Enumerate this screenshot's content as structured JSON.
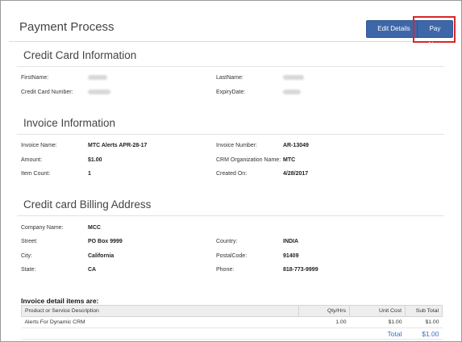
{
  "header": {
    "title": "Payment Process",
    "edit_label": "Edit Details",
    "pay_label": "Pay Now"
  },
  "credit_card": {
    "title": "Credit Card Information",
    "first_name_label": "FirstName:",
    "last_name_label": "LastName:",
    "card_number_label": "Credit Card Number:",
    "expiry_label": "ExpiryDate:"
  },
  "invoice": {
    "title": "Invoice Information",
    "name_label": "Invoice Name:",
    "name_value": "MTC Alerts APR-28-17",
    "number_label": "Invoice Number:",
    "number_value": "AR-13049",
    "amount_label": "Amount:",
    "amount_value": "$1.00",
    "crm_label": "CRM Organization Name:",
    "crm_value": "MTC",
    "count_label": "Item Count:",
    "count_value": "1",
    "created_label": "Created On:",
    "created_value": "4/28/2017"
  },
  "billing": {
    "title": "Credit card Billing Address",
    "company_label": "Company Name:",
    "company_value": "MCC",
    "street_label": "Street:",
    "street_value": "PO Box 9999",
    "country_label": "Country:",
    "country_value": "INDIA",
    "city_label": "City:",
    "city_value": "California",
    "postal_label": "PostalCode:",
    "postal_value": "91409",
    "state_label": "State:",
    "state_value": "CA",
    "phone_label": "Phone:",
    "phone_value": "818-773-9999"
  },
  "items": {
    "heading": "Invoice detail items are:",
    "columns": [
      "Product or Service Description",
      "Qty/Hrs",
      "Unit Cost",
      "Sub Total"
    ],
    "rows": [
      {
        "description": "Alerts For Dynamic CRM",
        "qty": "1.00",
        "unit": "$1.00",
        "subtotal": "$1.00"
      }
    ],
    "total_label": "Total",
    "total_value": "$1.00"
  }
}
